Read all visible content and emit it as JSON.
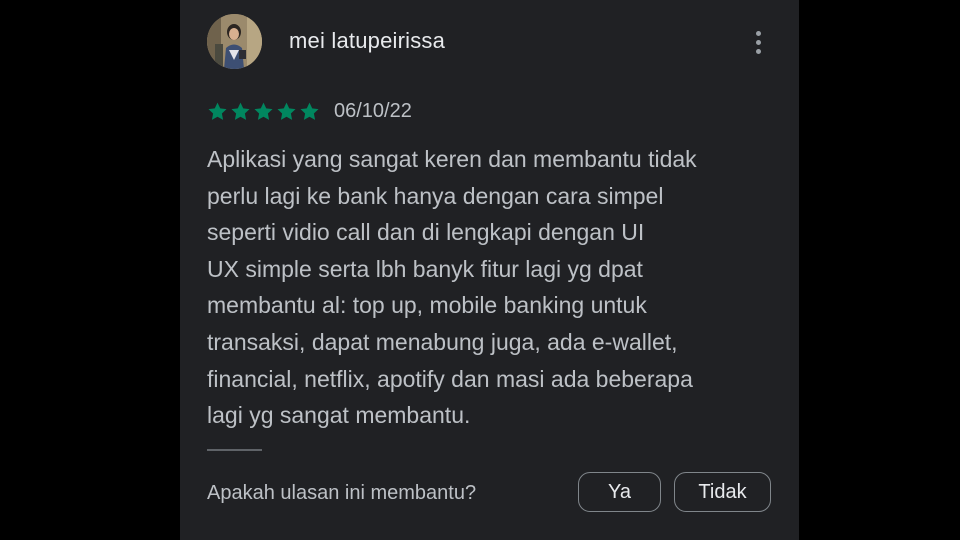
{
  "review": {
    "reviewer_name": "mei latupeirissa",
    "avatar_icon": "user-photo-avatar",
    "menu_icon": "more-vert-icon",
    "rating": 5,
    "rating_max": 5,
    "star_color": "#01875f",
    "date": "06/10/22",
    "text_lines": [
      "Aplikasi yang sangat keren dan membantu tidak",
      "perlu lagi ke bank hanya dengan cara simpel",
      "seperti vidio call dan di lengkapi dengan UI",
      "UX simple serta lbh banyk fitur lagi yg dpat",
      "membantu al: top up, mobile banking untuk",
      "transaksi, dapat menabung juga, ada e-wallet,",
      "financial, netflix, apotify dan masi ada beberapa",
      "lagi yg sangat membantu."
    ]
  },
  "helpful": {
    "question": "Apakah ulasan ini membantu?",
    "yes_label": "Ya",
    "no_label": "Tidak"
  }
}
